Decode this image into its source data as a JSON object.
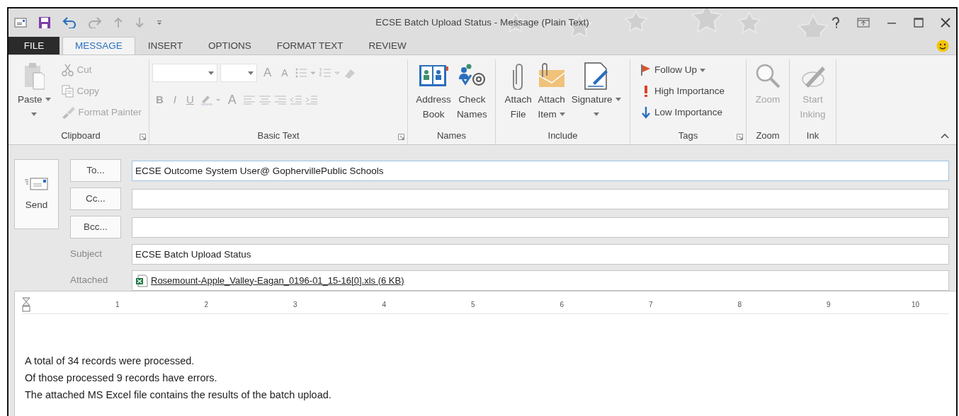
{
  "window": {
    "title": "ECSE Batch Upload Status - Message (Plain Text)"
  },
  "tabs": [
    {
      "label": "FILE",
      "kind": "file",
      "selected": false
    },
    {
      "label": "MESSAGE",
      "kind": "tab",
      "selected": true
    },
    {
      "label": "INSERT",
      "kind": "tab",
      "selected": false
    },
    {
      "label": "OPTIONS",
      "kind": "tab",
      "selected": false
    },
    {
      "label": "FORMAT TEXT",
      "kind": "tab",
      "selected": false
    },
    {
      "label": "REVIEW",
      "kind": "tab",
      "selected": false
    }
  ],
  "ribbon": {
    "groups": [
      {
        "label": "Clipboard",
        "kind": "clipboard",
        "launcher": true,
        "items": [
          {
            "kind": "large",
            "lines": [
              "Paste"
            ],
            "dropdown": true,
            "disabled": false
          },
          {
            "kind": "small",
            "label": "Cut",
            "disabled": true
          },
          {
            "kind": "small",
            "label": "Copy",
            "disabled": true
          },
          {
            "kind": "small",
            "label": "Format Painter",
            "disabled": true
          }
        ]
      },
      {
        "label": "Basic Text",
        "kind": "basic-text",
        "launcher": true,
        "disabled": true,
        "row1": [
          "A",
          "A"
        ],
        "row2": [
          "B",
          "I",
          "U",
          "A"
        ]
      },
      {
        "label": "Names",
        "kind": "buttons",
        "launcher": false,
        "items": [
          {
            "kind": "large",
            "lines": [
              "Address",
              "Book"
            ],
            "dropdown": false,
            "disabled": false
          },
          {
            "kind": "large",
            "lines": [
              "Check",
              "Names"
            ],
            "dropdown": false,
            "disabled": false
          }
        ]
      },
      {
        "label": "Include",
        "kind": "buttons",
        "launcher": false,
        "items": [
          {
            "kind": "large",
            "lines": [
              "Attach",
              "File"
            ],
            "dropdown": false,
            "disabled": false
          },
          {
            "kind": "large",
            "lines": [
              "Attach",
              "Item"
            ],
            "dropdown": true,
            "disabled": false
          },
          {
            "kind": "large",
            "lines": [
              "Signature"
            ],
            "dropdown": true,
            "disabled": false
          }
        ]
      },
      {
        "label": "Tags",
        "kind": "tags",
        "launcher": true,
        "items": [
          {
            "kind": "small",
            "label": "Follow Up",
            "dropdown": true,
            "disabled": false
          },
          {
            "kind": "small",
            "label": "High Importance",
            "disabled": false
          },
          {
            "kind": "small",
            "label": "Low Importance",
            "disabled": false
          }
        ]
      },
      {
        "label": "Zoom",
        "kind": "buttons",
        "launcher": false,
        "items": [
          {
            "kind": "large",
            "lines": [
              "Zoom"
            ],
            "dropdown": false,
            "disabled": true
          }
        ]
      },
      {
        "label": "Ink",
        "kind": "buttons",
        "launcher": false,
        "items": [
          {
            "kind": "large",
            "lines": [
              "Start",
              "Inking"
            ],
            "dropdown": false,
            "disabled": true
          }
        ]
      }
    ]
  },
  "send": {
    "label": "Send"
  },
  "fields": [
    {
      "kind": "button",
      "button": "To...",
      "value": "ECSE Outcome System User@ GophervillePublic Schools",
      "focused": true
    },
    {
      "kind": "button",
      "button": "Cc...",
      "focused": false
    },
    {
      "kind": "button",
      "button": "Bcc...",
      "focused": false
    },
    {
      "kind": "label",
      "label": "Subject",
      "value": "ECSE Batch Upload Status",
      "focused": false
    },
    {
      "kind": "attachment",
      "label": "Attached",
      "file": "Rosemount-Apple_Valley-Eagan_0196-01_15-16[0].xls (6 KB)",
      "focused": false
    }
  ],
  "ruler": {
    "numbers": [
      "1",
      "2",
      "3",
      "4",
      "5",
      "6",
      "7",
      "8",
      "9",
      "10"
    ]
  },
  "body": {
    "lines": [
      "A total of 34 records were processed.",
      "Of those processed 9 records have errors.",
      "The attached MS Excel file contains the results of the batch upload."
    ]
  }
}
